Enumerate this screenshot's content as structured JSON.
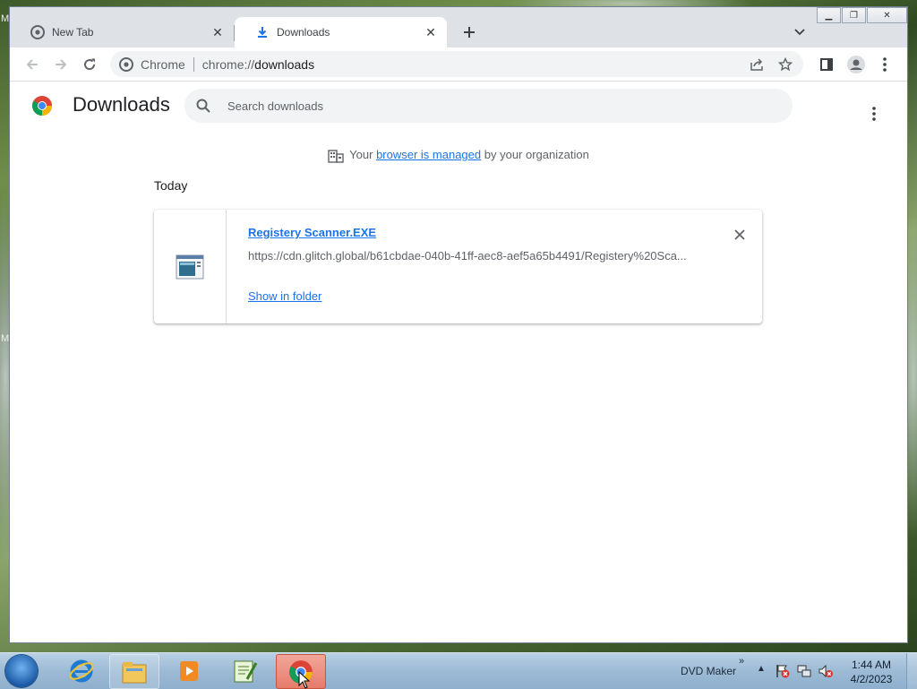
{
  "browser": {
    "tabs": [
      {
        "title": "New Tab"
      },
      {
        "title": "Downloads"
      }
    ],
    "omnibox": {
      "scheme_label": "Chrome",
      "url_prefix": "chrome://",
      "url_host": "downloads"
    }
  },
  "downloads_page": {
    "title": "Downloads",
    "search_placeholder": "Search downloads",
    "managed": {
      "prefix": "Your",
      "link": "browser is managed",
      "suffix": "by your organization"
    },
    "section": "Today",
    "items": [
      {
        "filename": "Registery Scanner.EXE",
        "url": "https://cdn.glitch.global/b61cbdae-040b-41ff-aec8-aef5a65b4491/Registery%20Sca...",
        "action": "Show in folder"
      }
    ]
  },
  "taskbar": {
    "toolbar_label": "DVD Maker",
    "time": "1:44 AM",
    "date": "4/2/2023"
  },
  "colors": {
    "accent": "#1a73e8",
    "tabstrip": "#dee1e6",
    "taskbar": "#9fbcd6"
  }
}
